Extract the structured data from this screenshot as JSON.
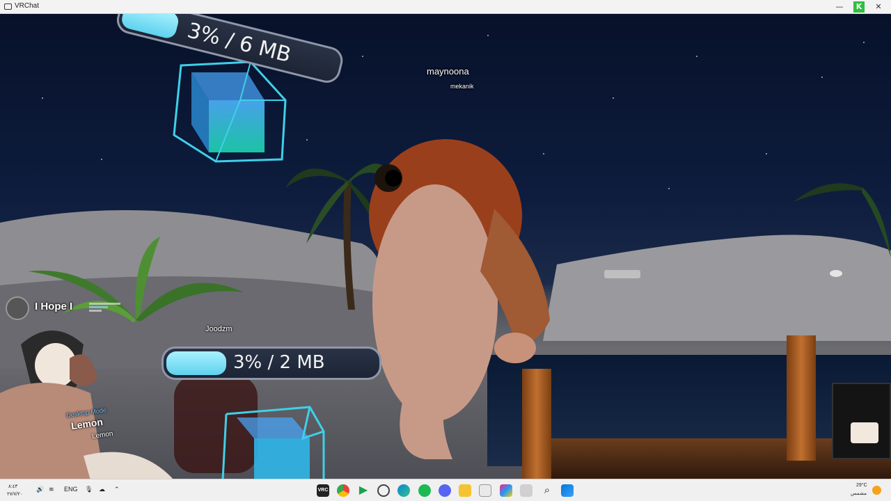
{
  "window": {
    "title": "VRChat",
    "minimize": "—",
    "maximize": "□",
    "close": "✕"
  },
  "nameplates": {
    "top_name": "maynoona",
    "top_sub": "mekanik",
    "left_text": "I Hope I",
    "joodzm": "Joodzm",
    "desktop_mode": "Desktop Mode",
    "lemon": "Lemon",
    "lemon_sub": "Lemon"
  },
  "downloads": [
    {
      "text": "3% / 6 MB",
      "progress": 0.03
    },
    {
      "text": "3% / 2 MB",
      "progress": 0.03
    }
  ],
  "taskbar": {
    "time": "٨:٤٣",
    "date": "٢٧/٧/٢٠",
    "language": "ENG",
    "weather_temp": "29°C",
    "weather_desc": "مشمس",
    "apps": [
      "vrchat-icon",
      "chrome-icon",
      "play-icon",
      "steam-icon",
      "edge-icon",
      "spotify-icon",
      "discord-icon",
      "file-explorer-icon",
      "store-icon",
      "copilot-icon",
      "notes-icon",
      "search-icon",
      "start-icon"
    ],
    "vrc_label": "VRC"
  },
  "colors": {
    "accent_cube": "#3fd0e8",
    "progress_fill": "#7fe0f6"
  }
}
